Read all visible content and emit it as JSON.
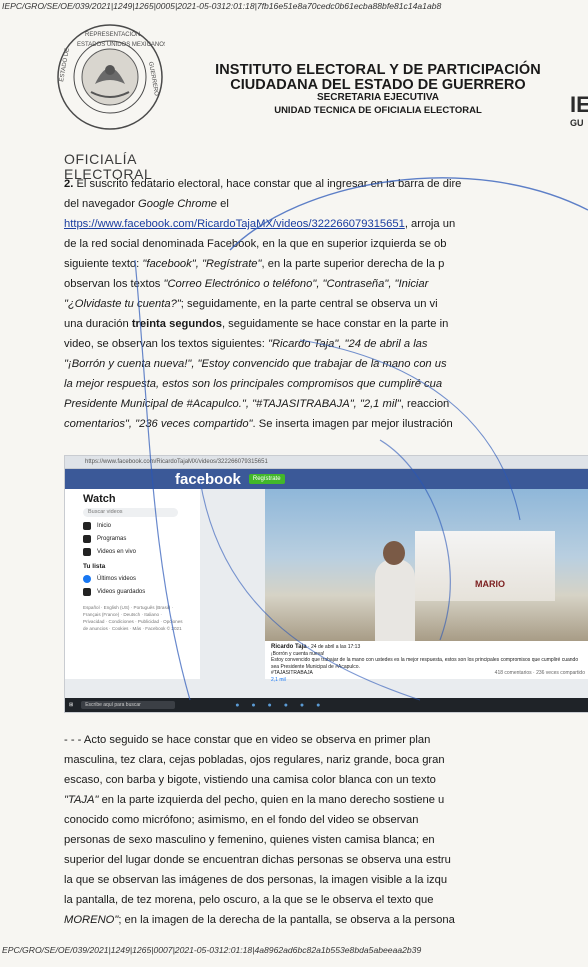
{
  "header_code": "IEPC/GRO/SE/OE/039/2021|1249|1265|0005|2021-05-0312:01:18|7fb16e51e8a70cedc0b61ecba88bfe81c14a1ab8",
  "seal_text": "REPRESENTACIÓN CIUDADANA · ESTADOS UNIDOS MEXICANOS · ESTADO DE GUERRERO · INSTITUTO ELECTORAL",
  "institute": {
    "line1": "INSTITUTO ELECTORAL Y DE PARTICIPACIÓN",
    "line2": "CIUDADANA DEL ESTADO DE GUERRERO",
    "line3": "SECRETARIA EJECUTIVA",
    "line4": "UNIDAD TECNICA DE OFICIALIA ELECTORAL"
  },
  "right_logo": {
    "mark": "IE",
    "sub": "GU"
  },
  "oficialia": {
    "line1": "OFICIALÍA",
    "line2": "ELECTORAL"
  },
  "para1": {
    "num": "2.",
    "l1": "El suscrito fedatario electoral, hace constar que al ingresar en la barra de dire",
    "l2a": "del",
    "l2b": "navegador",
    "l2c": "Google",
    "l2d": "Chrome",
    "l2e": "el",
    "l3_link": "https://www.facebook.com/RicardoTajaMX/videos/322266079315651",
    "l3_rest": ", arroja un",
    "l4": "de la red social denominada Facebook, en la que en superior izquierda se ob",
    "l5a": "siguiente texto: ",
    "l5b": "\"facebook\", \"Regístrate\"",
    "l5c": ", en la parte superior derecha de la p",
    "l6a": "observan los textos ",
    "l6b": "\"Correo Electrónico o teléfono\", \"Contraseña\", \"Iniciar",
    "l7a": "\"¿Olvidaste tu cuenta?\"",
    "l7b": "; seguidamente, en la parte central se observa un vi",
    "l8a": "una duración ",
    "l8b": "treinta segundos",
    "l8c": ", seguidamente se hace constar en la parte in",
    "l9a": "video, se observan los textos siguientes: ",
    "l9b": "\"Ricardo Taja\", \"24 de abril a las",
    "l10": "\"¡Borrón y cuenta nueva!\", \"Estoy convencido que trabajar de la mano con us",
    "l11": "la mejor respuesta, estos son los principales compromisos que cumpliré cua",
    "l12a": "Presidente Municipal de #Acapulco.\", \"#TAJASITRABAJA\", \"2,1 mil\"",
    "l12b": ", reaccion",
    "l13a": "comentarios\", \"236 veces compartido\"",
    "l13b": ". Se inserta imagen par mejor ilustración"
  },
  "screenshot": {
    "url": "https://www.facebook.com/RicardoTajaMX/videos/322266079315651",
    "brand": "facebook",
    "register": "Regístrate",
    "sidebar_title": "Watch",
    "search": "Buscar videos",
    "items": [
      "Inicio",
      "Programas",
      "Videos en vivo"
    ],
    "section": "Tu lista",
    "list_items": [
      "Últimos videos",
      "Videos guardados"
    ],
    "footer": "Español · English (US) · Português (Brasil) · Français (France) · Deutsch · Italiano · Privacidad · Condiciones · Publicidad · Opciones de anuncios · Cookies · Más · Facebook © 2021",
    "banner": "MARIO",
    "post_name": "Ricardo Taja",
    "post_date": "24 de abril a las 17:13",
    "post_line1": "¡Borrón y cuenta nueva!",
    "post_line2": "Estoy convencido que trabajar de la mano con ustedes es la mejor respuesta, estos son los principales compromisos que cumpliré cuando sea Presidente Municipal de #Acapulco.",
    "post_tag": "#TAJASITRABAJA",
    "reactions": "2,1 mil",
    "stats": "418 comentarios · 236 veces compartido",
    "taskbar_search": "Escribe aquí para buscar"
  },
  "para2": {
    "l1": "- - - Acto seguido se hace constar que en video se observa en primer plan",
    "l2": "masculina, tez clara, cejas pobladas, ojos regulares, nariz grande, boca gran",
    "l3": "escaso, con barba y bigote, vistiendo una camisa color blanca con un texto",
    "l4a": "\"TAJA\"",
    "l4b": " en la parte izquierda del pecho, quien en la mano derecho sostiene u",
    "l5": "conocido como micrófono; asimismo, en el fondo del video se observan",
    "l6": "personas de sexo masculino y femenino, quienes visten camisa blanca; en",
    "l7": "superior del lugar donde se encuentran dichas personas se observa una estru",
    "l8": "la que se observan las imágenes de dos personas, la imagen visible a la izqu",
    "l9a": "la pantalla, de tez morena, pelo oscuro, a la que se le observa el texto que",
    "l10a": "MORENO\"",
    "l10b": "; en la imagen de la derecha de la pantalla, se observa a la persona"
  },
  "footer_code": "EPC/GRO/SE/OE/039/2021|1249|1265|0007|2021-05-0312:01:18|4a8962ad6bc82a1b553e8bda5abeeaa2b39"
}
